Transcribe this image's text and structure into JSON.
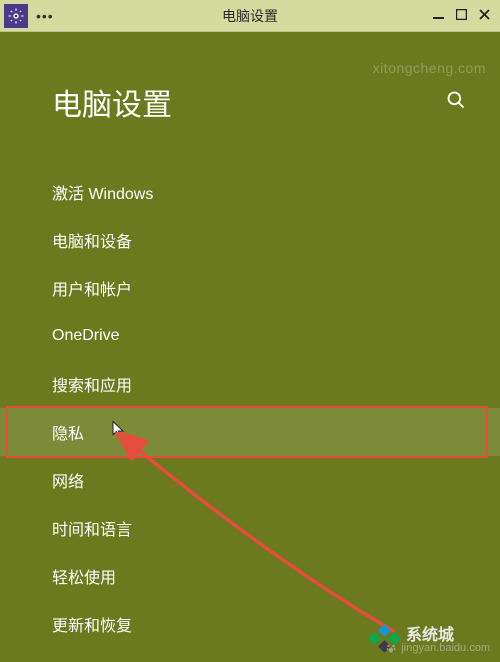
{
  "titlebar": {
    "title": "电脑设置",
    "menu_dots": "•••"
  },
  "header": {
    "title": "电脑设置"
  },
  "nav": {
    "items": [
      {
        "label": "激活 Windows",
        "selected": false
      },
      {
        "label": "电脑和设备",
        "selected": false
      },
      {
        "label": "用户和帐户",
        "selected": false
      },
      {
        "label": "OneDrive",
        "selected": false
      },
      {
        "label": "搜索和应用",
        "selected": false
      },
      {
        "label": "隐私",
        "selected": true
      },
      {
        "label": "网络",
        "selected": false
      },
      {
        "label": "时间和语言",
        "selected": false
      },
      {
        "label": "轻松使用",
        "selected": false
      },
      {
        "label": "更新和恢复",
        "selected": false
      }
    ]
  },
  "watermarks": {
    "top": "xitongcheng.com",
    "bottom": "jingyan.baidu.com"
  }
}
